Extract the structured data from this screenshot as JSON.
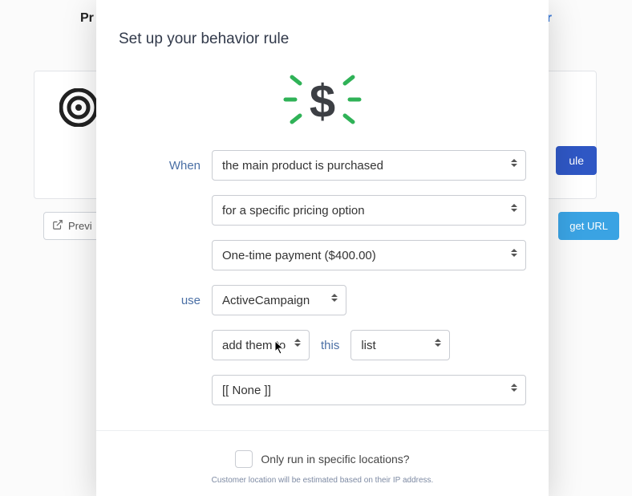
{
  "backdrop": {
    "top_left_text": "Pr",
    "top_right_text": "or",
    "rule_button": "ule",
    "preview_button": "Previ",
    "get_url_button": "get URL"
  },
  "modal": {
    "title": "Set up your behavior rule",
    "labels": {
      "when": "When",
      "use": "use",
      "this": "this"
    },
    "selects": {
      "trigger": "the main product is purchased",
      "condition": "for a specific pricing option",
      "pricing": "One-time payment ($400.00)",
      "integration": "ActiveCampaign",
      "action": "add them to",
      "object_type": "list",
      "target": "[[ None ]]"
    },
    "footer": {
      "checkbox_label": "Only run in specific locations?",
      "hint": "Customer location will be estimated based on their IP address."
    },
    "icon_color_accent": "#2fb257",
    "icon_color_dollar": "#3c3f44"
  }
}
